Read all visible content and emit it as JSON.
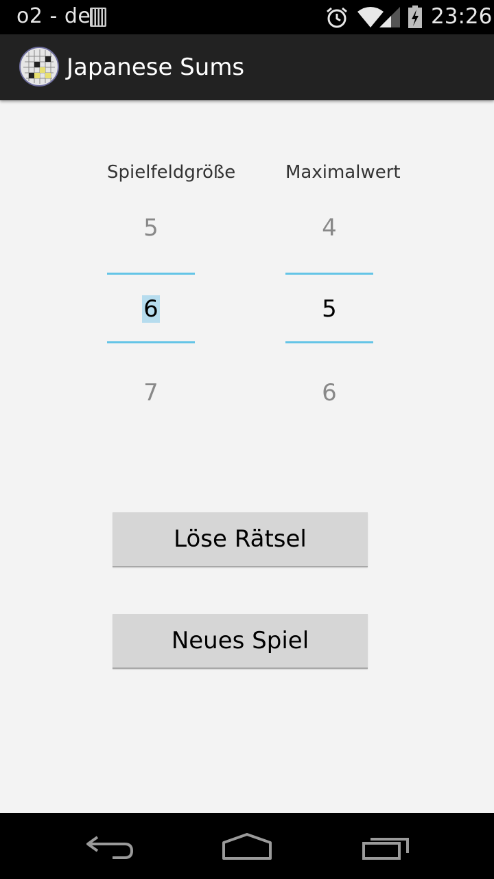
{
  "status_bar": {
    "carrier": "o2 - de",
    "time": "23:26",
    "icons": [
      "sim-icon",
      "alarm-icon",
      "wifi-icon",
      "signal-icon",
      "battery-charging-icon"
    ]
  },
  "action_bar": {
    "title": "Japanese Sums",
    "icon": "app-icon"
  },
  "pickers": {
    "board_size": {
      "label": "Spielfeldgröße",
      "prev": "5",
      "current": "6",
      "next": "7"
    },
    "max_value": {
      "label": "Maximalwert",
      "prev": "4",
      "current": "5",
      "next": "6"
    }
  },
  "buttons": {
    "solve": "Löse Rätsel",
    "new_game": "Neues Spiel"
  },
  "nav_bar": {
    "icons": [
      "back-icon",
      "home-icon",
      "recent-apps-icon"
    ]
  },
  "colors": {
    "picker_divider": "#64c4e6",
    "selection_highlight": "#b6dcee",
    "action_bar": "#222222",
    "background": "#f3f3f3",
    "button": "#d6d6d6"
  }
}
